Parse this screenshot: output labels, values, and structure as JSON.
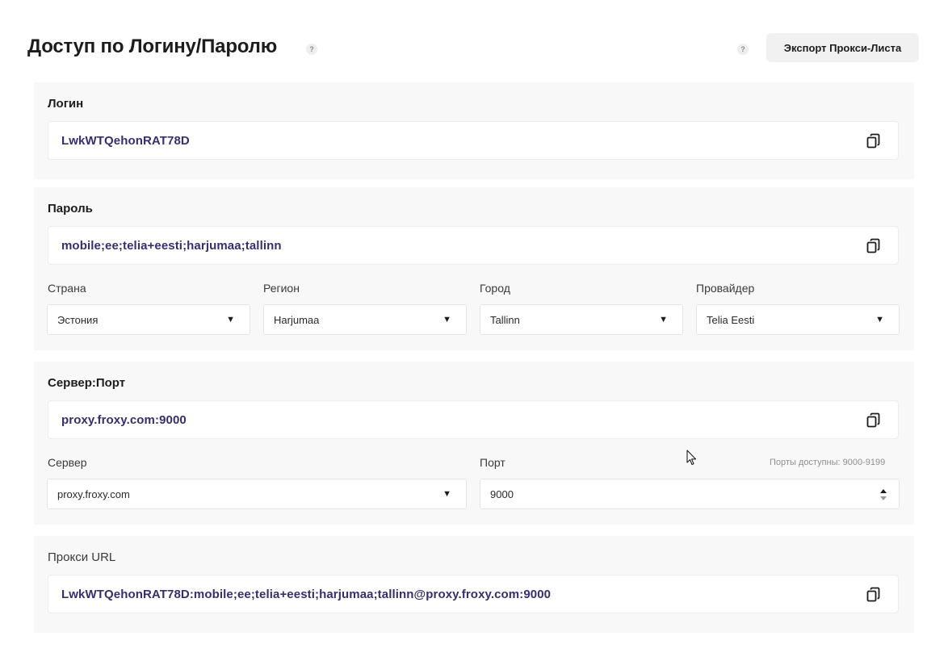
{
  "header": {
    "title": "Доступ по Логину/Паролю",
    "help_glyph": "?",
    "export_label": "Экспорт Прокси-Листа"
  },
  "login": {
    "label": "Логин",
    "value": "LwkWTQehonRAT78D"
  },
  "password": {
    "label": "Пароль",
    "value": "mobile;ee;telia+eesti;harjumaa;tallinn",
    "filters": [
      {
        "label": "Страна",
        "value": "Эстония"
      },
      {
        "label": "Регион",
        "value": "Harjumaa"
      },
      {
        "label": "Город",
        "value": "Tallinn"
      },
      {
        "label": "Провайдер",
        "value": "Telia Eesti"
      }
    ]
  },
  "server_port": {
    "label": "Сервер:Порт",
    "value": "proxy.froxy.com:9000",
    "server_label": "Сервер",
    "server_value": "proxy.froxy.com",
    "port_label": "Порт",
    "port_value": "9000",
    "ports_note": "Порты доступны: 9000-9199"
  },
  "proxy_url": {
    "label": "Прокси URL",
    "value": "LwkWTQehonRAT78D:mobile;ee;telia+eesti;harjumaa;tallinn@proxy.froxy.com:9000"
  },
  "icons": {
    "copy": "copy-icon",
    "caret": "▼",
    "help": "help-icon"
  },
  "colors": {
    "value_text": "#3a2d6f",
    "panel_bg": "#f8f8f8",
    "button_bg": "#f1f1f1"
  }
}
